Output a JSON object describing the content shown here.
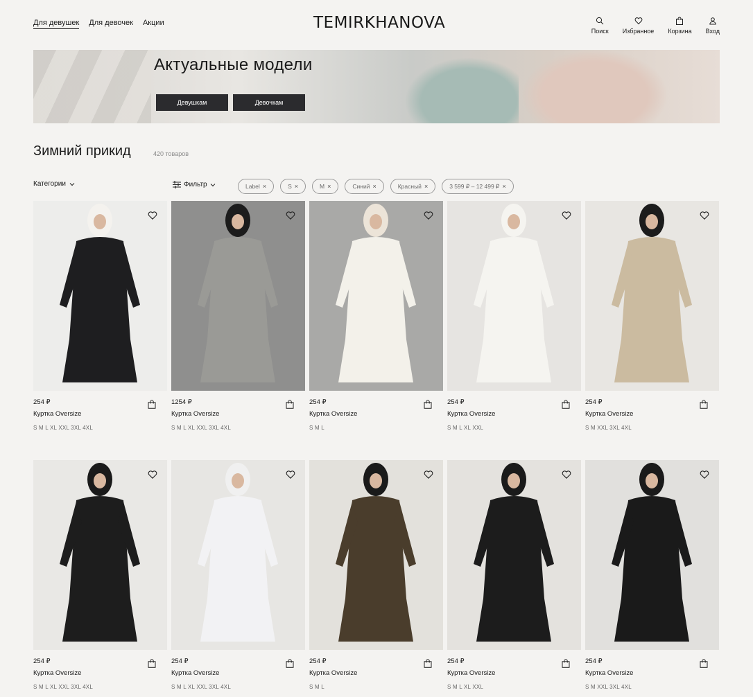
{
  "header": {
    "nav_left": [
      "Для девушек",
      "Для девочек",
      "Акции"
    ],
    "logo": "TEMIRKHANOVA",
    "nav_right": {
      "search": "Поиск",
      "favorites": "Избранное",
      "cart": "Корзина",
      "login": "Вход"
    }
  },
  "banner": {
    "title": "Актуальные модели",
    "button_girls": "Девушкам",
    "button_kids": "Девочкам"
  },
  "section": {
    "title": "Зимний прикид",
    "count": "420 товаров"
  },
  "filters": {
    "categories": "Категории",
    "filter": "Фильтр",
    "chips": [
      "Label",
      "S",
      "M",
      "Синий",
      "Красный",
      "3 599 ₽ – 12 499 ₽"
    ]
  },
  "products": [
    {
      "price": "254 ₽",
      "name": "Куртка Oversize",
      "sizes": "S  M  L  XL  XXL  3XL  4XL",
      "bg": "#ededeb",
      "garment": "#1e1e20",
      "head": "#f4f2ee"
    },
    {
      "price": "1254 ₽",
      "name": "Куртка Oversize",
      "sizes": "S  M  L  XL  XXL  3XL  4XL",
      "bg": "#8f8f8e",
      "garment": "#9a9a96",
      "head": "#1c1c1c"
    },
    {
      "price": "254 ₽",
      "name": "Куртка Oversize",
      "sizes": "S  M  L",
      "bg": "#a9a9a7",
      "garment": "#f3f1ea",
      "head": "#ece4d8"
    },
    {
      "price": "254 ₽",
      "name": "Куртка Oversize",
      "sizes": "S  M  L  XL  XXL",
      "bg": "#e6e4e1",
      "garment": "#f5f4f0",
      "head": "#f5f4f0"
    },
    {
      "price": "254 ₽",
      "name": "Куртка Oversize",
      "sizes": "S  M  XXL  3XL  4XL",
      "bg": "#e8e6e2",
      "garment": "#cbbba0",
      "head": "#1c1c1c"
    },
    {
      "price": "254 ₽",
      "name": "Куртка Oversize",
      "sizes": "S  M  L  XL  XXL  3XL  4XL",
      "bg": "#e9e8e5",
      "garment": "#1d1d1d",
      "head": "#1a1a1a"
    },
    {
      "price": "254 ₽",
      "name": "Куртка Oversize",
      "sizes": "S  M  L  XL  XXL  3XL  4XL",
      "bg": "#e7e6e3",
      "garment": "#f2f2f4",
      "head": "#f0f0f0"
    },
    {
      "price": "254 ₽",
      "name": "Куртка Oversize",
      "sizes": "S  M  L",
      "bg": "#e3e1dc",
      "garment": "#4a3d2c",
      "head": "#1a1a1a"
    },
    {
      "price": "254 ₽",
      "name": "Куртка Oversize",
      "sizes": "S  M  L  XL  XXL",
      "bg": "#e4e2de",
      "garment": "#1c1c1c",
      "head": "#1a1a1a"
    },
    {
      "price": "254 ₽",
      "name": "Куртка Oversize",
      "sizes": "S  M  XXL  3XL  4XL",
      "bg": "#e1e0dd",
      "garment": "#1a1a1a",
      "head": "#1a1a1a"
    }
  ]
}
